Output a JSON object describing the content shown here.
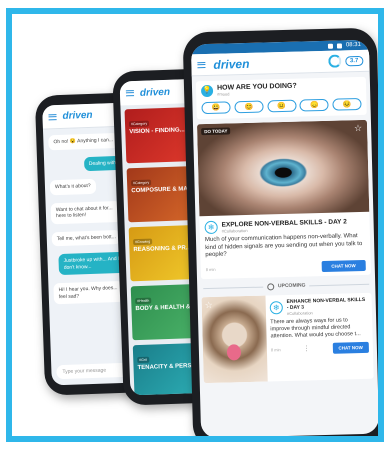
{
  "colors": {
    "frame_border": "#2fb7ea",
    "brand_blue": "#1f8fd9",
    "chat_out": "#25b3c5",
    "button_blue": "#2a7fe0"
  },
  "chat_phone": {
    "brand": "driven",
    "messages": [
      {
        "dir": "in",
        "text": "Oh no! 😮 Anything I can..."
      },
      {
        "dir": "out",
        "text": "Dealing with..."
      },
      {
        "dir": "in",
        "text": "What's it about?"
      },
      {
        "dir": "in",
        "text": "Want to chat about it for... here to listen!"
      },
      {
        "dir": "in",
        "text": "Tell me, what's been bott..."
      },
      {
        "dir": "out",
        "text": "Justbroke up with... And I don't know..."
      },
      {
        "dir": "in",
        "text": "Hi! I hear you. Why does... feel sad?"
      }
    ],
    "input_placeholder": "Type your message"
  },
  "category_phone": {
    "brand": "driven",
    "categories": [
      {
        "tag": "#Category",
        "title": "VISION - FINDING..."
      },
      {
        "tag": "#Category",
        "title": "COMPOSURE & MA... SKILLS"
      },
      {
        "tag": "#Growing",
        "title": "REASONING & PR..."
      },
      {
        "tag": "#Health",
        "title": "BODY & HEALTH &..."
      },
      {
        "tag": "#Grit",
        "title": "TENACITY & PERS..."
      }
    ]
  },
  "main_phone": {
    "status_time": "08:31",
    "brand": "driven",
    "score": "3.7",
    "mood": {
      "title": "HOW ARE YOU DOING?",
      "subtitle": "#mood",
      "emojis": [
        "😀",
        "😊",
        "😐",
        "😞",
        "😣"
      ]
    },
    "card1": {
      "badge": "DO TODAY",
      "title": "EXPLORE NON-VERBAL SKILLS - DAY 2",
      "byline": "#Collaboration",
      "text": "Much of your communication happens non-verbally. What kind of hidden signals are you sending out when you talk to people?",
      "meta": "8 min",
      "button": "CHAT NOW"
    },
    "upcoming_label": "UPCOMING",
    "card2": {
      "title": "ENHANCE NON-VERBAL SKILLS - DAY 3",
      "byline": "#Collaboration",
      "text": "There are always ways for us to improve through mindful directed attention. What would you choose t...",
      "meta": "8 min",
      "button": "CHAT NOW"
    }
  }
}
